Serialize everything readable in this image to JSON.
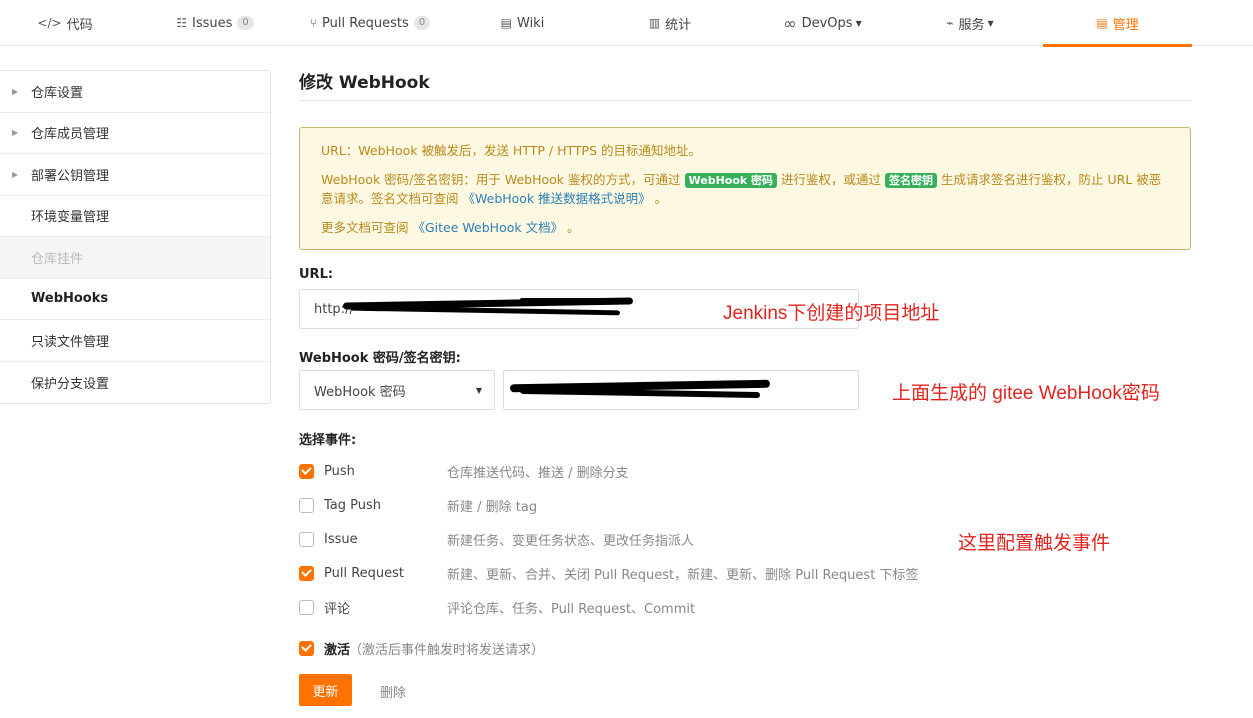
{
  "tabs": [
    {
      "icon": "</>",
      "label": "代码",
      "badge": ""
    },
    {
      "icon": "☷",
      "label": "Issues",
      "badge": "0"
    },
    {
      "icon": "⑂",
      "label": "Pull Requests",
      "badge": "0"
    },
    {
      "icon": "▤",
      "label": "Wiki",
      "badge": ""
    },
    {
      "icon": "▥",
      "label": "统计",
      "badge": ""
    },
    {
      "icon": "∞",
      "label": "DevOps",
      "badge": ""
    },
    {
      "icon": "⌁",
      "label": "服务",
      "badge": ""
    },
    {
      "icon": "▤",
      "label": "管理",
      "badge": ""
    }
  ],
  "sidebar": {
    "items": [
      {
        "label": "仓库设置"
      },
      {
        "label": "仓库成员管理"
      },
      {
        "label": "部署公钥管理"
      },
      {
        "label": "环境变量管理"
      },
      {
        "label": "仓库挂件"
      },
      {
        "label": "WebHooks"
      },
      {
        "label": "只读文件管理"
      },
      {
        "label": "保护分支设置"
      }
    ]
  },
  "page": {
    "title": "修改 WebHook"
  },
  "notice": {
    "line1": "URL：WebHook 被触发后，发送 HTTP / HTTPS 的目标通知地址。",
    "line2_a": "WebHook 密码/签名密钥：用于 WebHook 鉴权的方式，可通过",
    "pill_password": "WebHook 密码",
    "line2_b": "进行鉴权，或通过",
    "pill_signature": "签名密钥",
    "line2_c": "生成请求签名进行鉴权，防止 URL 被恶意请求。签名文档可查阅",
    "link_push_format": "《WebHook 推送数据格式说明》",
    "line2_end": "。",
    "line3_a": "更多文档可查阅",
    "link_docs": "《Gitee WebHook 文档》",
    "line3_end": "。"
  },
  "form": {
    "url_label": "URL:",
    "url_prefix": "http://",
    "secret_label": "WebHook 密码/签名密钥:",
    "secret_type": "WebHook 密码",
    "events_label": "选择事件:"
  },
  "events": [
    {
      "name": "Push",
      "desc": "仓库推送代码、推送 / 删除分支",
      "checked": true
    },
    {
      "name": "Tag Push",
      "desc": "新建 / 删除 tag",
      "checked": false
    },
    {
      "name": "Issue",
      "desc": "新建任务、变更任务状态、更改任务指派人",
      "checked": false
    },
    {
      "name": "Pull Request",
      "desc": "新建、更新、合并、关闭 Pull Request，新建、更新、删除 Pull Request 下标签",
      "checked": true
    },
    {
      "name": "评论",
      "desc": "评论仓库、任务、Pull Request、Commit",
      "checked": false
    }
  ],
  "activate": {
    "label": "激活",
    "hint": "（激活后事件触发时将发送请求）",
    "checked": true
  },
  "buttons": {
    "update": "更新",
    "delete": "删除"
  },
  "annotations": {
    "url": "Jenkins下创建的项目地址",
    "secret": "上面生成的 gitee WebHook密码",
    "events": "这里配置触发事件"
  },
  "colors": {
    "accent": "#fe7300",
    "annotation": "#e0251f",
    "pill": "#36b05b"
  }
}
